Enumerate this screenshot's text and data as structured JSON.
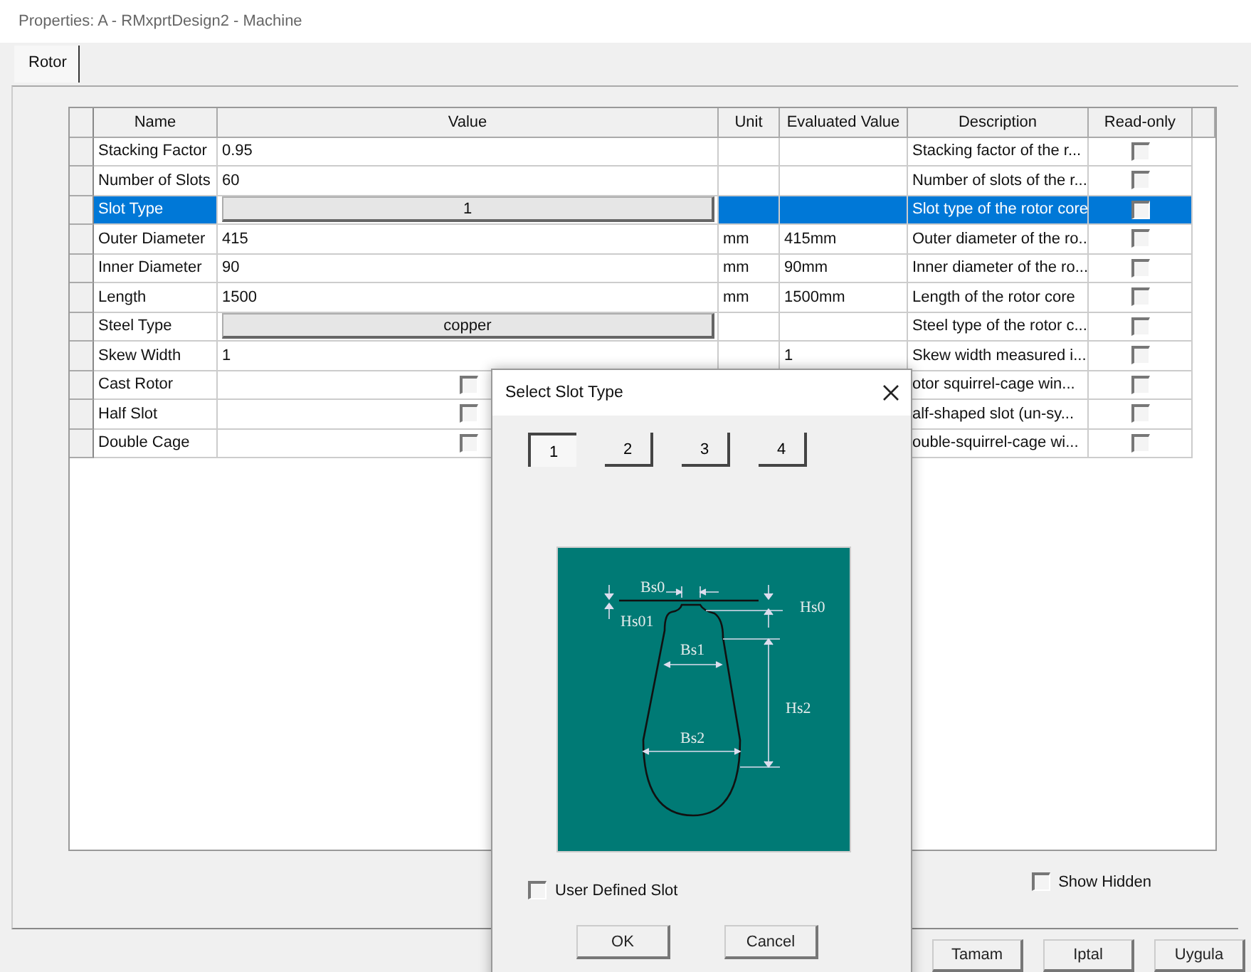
{
  "window": {
    "title": "Properties: A - RMxprtDesign2 - Machine"
  },
  "tabs": [
    {
      "label": "Rotor",
      "selected": true
    }
  ],
  "table": {
    "columns": [
      "Name",
      "Value",
      "Unit",
      "Evaluated Value",
      "Description",
      "Read-only"
    ],
    "rows": [
      {
        "name": "Stacking Factor",
        "kind": "text",
        "value": "0.95",
        "description": "Stacking factor of the r...",
        "read_only": false,
        "selected": false
      },
      {
        "name": "Number of Slots",
        "kind": "text",
        "value": "60",
        "description": "Number of slots of the r...",
        "read_only": false,
        "selected": false
      },
      {
        "name": "Slot Type",
        "kind": "button",
        "value": "1",
        "description": "Slot type of the rotor core",
        "read_only": false,
        "selected": true
      },
      {
        "name": "Outer Diameter",
        "kind": "text",
        "value": "415",
        "unit": "mm",
        "evaluated": "415mm",
        "description": "Outer diameter of the ro...",
        "read_only": false,
        "selected": false
      },
      {
        "name": "Inner Diameter",
        "kind": "text",
        "value": "90",
        "unit": "mm",
        "evaluated": "90mm",
        "description": "Inner diameter of the ro...",
        "read_only": false,
        "selected": false
      },
      {
        "name": "Length",
        "kind": "text",
        "value": "1500",
        "unit": "mm",
        "evaluated": "1500mm",
        "description": "Length of the rotor core",
        "read_only": false,
        "selected": false
      },
      {
        "name": "Steel Type",
        "kind": "button",
        "value": "copper",
        "description": "Steel type of the rotor c...",
        "read_only": false,
        "selected": false
      },
      {
        "name": "Skew Width",
        "kind": "text",
        "value": "1",
        "evaluated": "1",
        "description": "Skew width measured i...",
        "read_only": false,
        "selected": false
      },
      {
        "name": "Cast Rotor",
        "kind": "checkbox",
        "checked": false,
        "description": "otor squirrel-cage win...",
        "read_only": false,
        "selected": false
      },
      {
        "name": "Half Slot",
        "kind": "checkbox",
        "checked": false,
        "description": "alf-shaped slot (un-sy...",
        "read_only": false,
        "selected": false
      },
      {
        "name": "Double Cage",
        "kind": "checkbox",
        "checked": false,
        "description": "ouble-squirrel-cage wi...",
        "read_only": false,
        "selected": false
      }
    ]
  },
  "show_hidden": {
    "label": "Show Hidden",
    "checked": false
  },
  "buttons": [
    "Tamam",
    "Iptal",
    "Uygula"
  ],
  "dialog": {
    "title": "Select Slot Type",
    "slot_tabs": [
      {
        "label": "1",
        "selected": true
      },
      {
        "label": "2",
        "selected": false
      },
      {
        "label": "3",
        "selected": false
      },
      {
        "label": "4",
        "selected": false
      }
    ],
    "diagram_labels": [
      "Bs0",
      "Hs0",
      "Hs01",
      "Bs1",
      "Hs2",
      "Bs2"
    ],
    "user_defined": {
      "label": "User Defined Slot",
      "checked": false
    },
    "buttons": [
      "OK",
      "Cancel"
    ]
  }
}
